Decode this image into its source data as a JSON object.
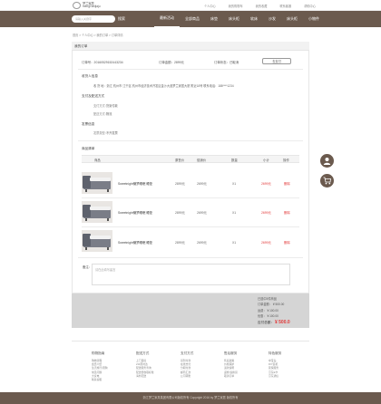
{
  "header": {
    "logo_text_line1": "梦兰家居",
    "logo_text_line2": "mengl ianjiaju",
    "links": [
      "个人中心",
      "我的购物车",
      "我的收藏",
      "联系客服",
      "帮助中心"
    ]
  },
  "nav": {
    "search_placeholder": "请输入关键字",
    "search_label": "搜索",
    "items": [
      "最新活动",
      "全部商品",
      "床垫",
      "床头柜",
      "软床",
      "沙发",
      "床头柜",
      "小物件"
    ]
  },
  "breadcrumb": "首页 > 个人中心 > 我的订单 > 订单详情",
  "order": {
    "panel_title": "我的订单",
    "number": "订单号：20160529152443234",
    "amount": "订单金额：2899元",
    "status": "订单状态：已取消",
    "pay_button": "去支付"
  },
  "receiver": {
    "title": "收货人信息",
    "address": "收 货 地：浙江 杭州市 江干区 杭州市经济技术开发区金沙大道梦兰家居大厦 附近18号 联系电话：188****1234"
  },
  "payment": {
    "title": "支付及配送方式",
    "pay_method_label": "支付方式：",
    "pay_method": "货到付款",
    "ship_method_label": "配送方式：",
    "ship_method": "物流"
  },
  "invoice": {
    "title": "发票信息",
    "type_label": "发票类型：",
    "type": "不开发票"
  },
  "products": {
    "title": "商品清单",
    "headers": [
      "商品",
      "原售价",
      "促销价",
      "数量",
      "小计",
      "操作"
    ],
    "rows": [
      {
        "name": "Sweetnight懒梦睡眠 睡垫",
        "orig": "2899元",
        "promo": "2699元",
        "qty": "X1",
        "subtotal": "2699元",
        "action": "删除"
      },
      {
        "name": "Sweetnight懒梦睡眠 睡垫",
        "orig": "2899元",
        "promo": "2699元",
        "qty": "X1",
        "subtotal": "2699元",
        "action": "删除"
      },
      {
        "name": "Sweetnight懒梦睡眠 睡垫",
        "orig": "2899元",
        "promo": "2699元",
        "qty": "X1",
        "subtotal": "2699元",
        "action": "删除"
      }
    ]
  },
  "remark": {
    "label": "备注：",
    "placeholder": "请在此填写留言"
  },
  "summary": {
    "count": "已选中3件商品",
    "order_amount": "订单金额：",
    "order_amount_value": "¥ 500.00",
    "freight": "运费：",
    "freight_value": "¥ 100.00",
    "discount": "优惠：",
    "discount_value": "¥ 100.00",
    "total_label": "应付总额：",
    "total_value": "¥ 500.0"
  },
  "footer": {
    "columns": [
      {
        "title": "购物指南",
        "items": [
          "购物流程",
          "会员介绍",
          "生活旅行/团购",
          "常见问题",
          "大家电",
          "联系客服"
        ]
      },
      {
        "title": "配送方式",
        "items": [
          "上门自提",
          "211限时达",
          "配送服务查询",
          "配送费收取标准",
          "海外配送"
        ]
      },
      {
        "title": "支付方式",
        "items": [
          "货到付款",
          "在线支付",
          "分期付款",
          "邮局汇款",
          "公司转账"
        ]
      },
      {
        "title": "售后服务",
        "items": [
          "售后政策",
          "价格保护",
          "退款说明",
          "返修/退换货",
          "取消订单"
        ]
      },
      {
        "title": "特色服务",
        "items": [
          "夺宝岛",
          "DIY装机",
          "延保服务",
          "京东E卡",
          "京东通信"
        ]
      }
    ],
    "copyright": "浙江梦兰家具集团有限公司版权所有 Copyright 2016 by 梦兰家居 版权所有"
  },
  "colors": {
    "brand": "#6b5a4e",
    "price_red": "#e23a3a",
    "summary_bg": "#d5d5d5"
  }
}
